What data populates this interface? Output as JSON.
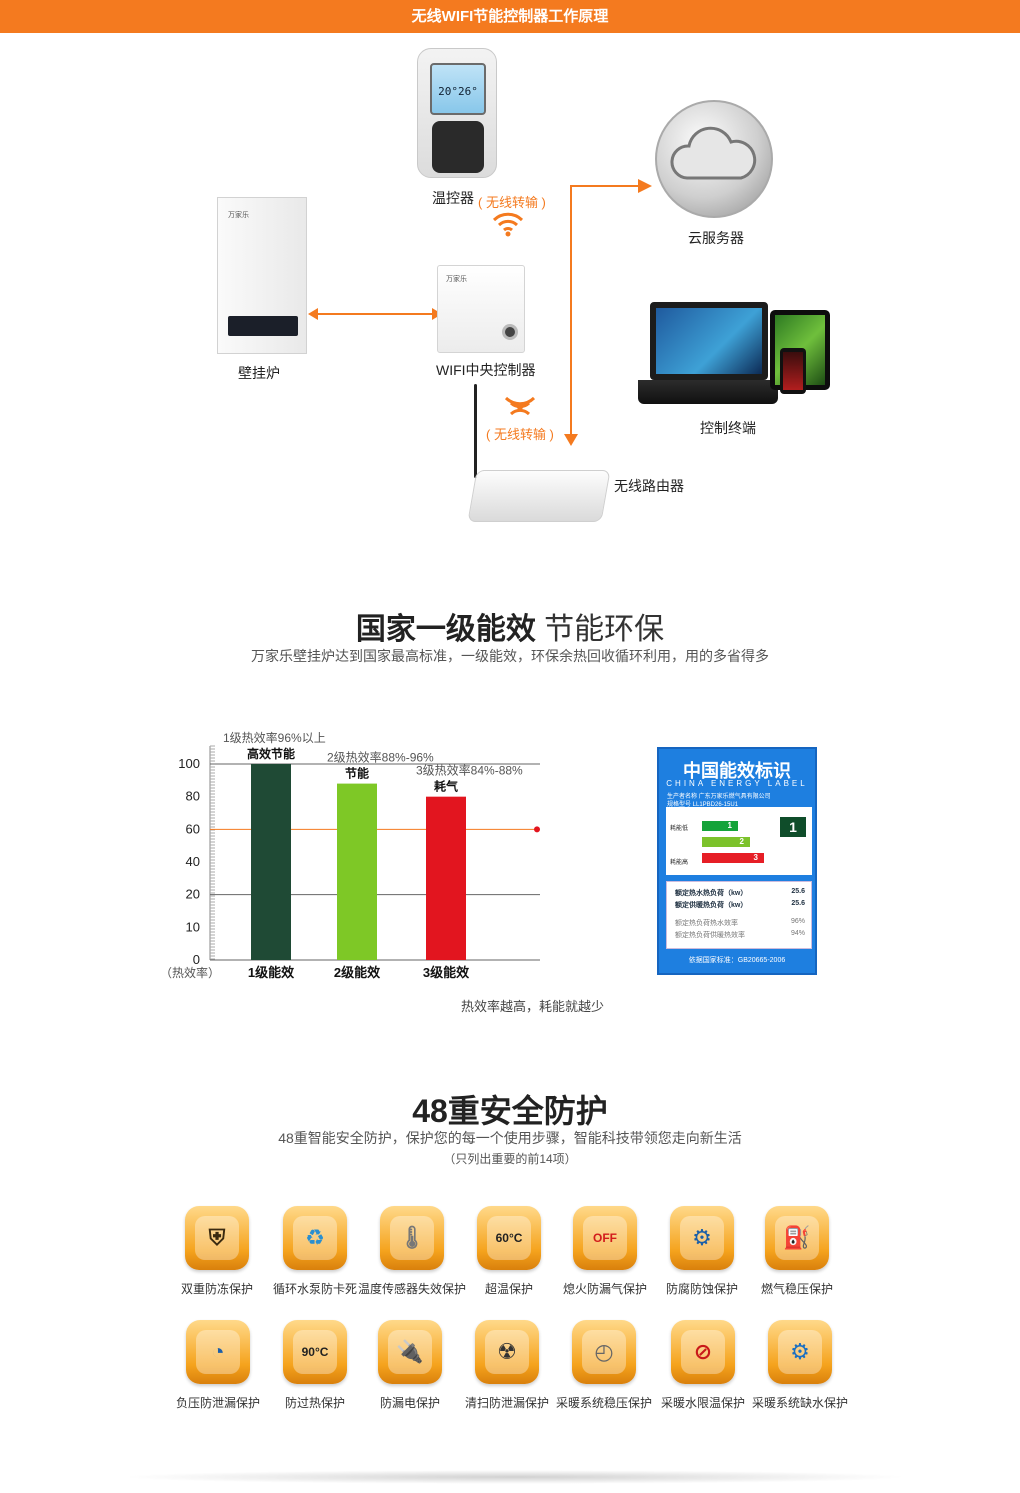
{
  "header": {
    "title": "无线WIFI节能控制器工作原理"
  },
  "diagram": {
    "thermostat_label": "温控器",
    "wireless_transfer_top": "( 无线转输 )",
    "thermostat_screen": "20°26°",
    "cloud_label": "云服务器",
    "boiler_label": "壁挂炉",
    "wifi_controller_label": "WIFI中央控制器",
    "terminal_label": "控制终端",
    "wireless_transfer_mid": "( 无线转输 )",
    "router_label": "无线路由器",
    "boiler_brand": "万家乐",
    "controller_brand": "万家乐"
  },
  "efficiency": {
    "title_bold": "国家一级能效",
    "title_light": "节能环保",
    "subtitle": "万家乐壁挂炉达到国家最高标准，一级能效，环保余热回收循环利用，用的多省得多",
    "caption": "热效率越高，耗能就越少"
  },
  "chart_data": {
    "type": "bar",
    "categories": [
      "1级能效",
      "2级能效",
      "3级能效"
    ],
    "values": [
      100,
      88,
      80
    ],
    "colors": [
      "#1f4a35",
      "#7ec826",
      "#e2151f"
    ],
    "bar_notes": [
      "1级热效率96%以上",
      "2级热效率88%-96%",
      "3级热效率84%-88%"
    ],
    "bar_titles": [
      "高效节能",
      "节能",
      "耗气"
    ],
    "ytick_labels": [
      "100",
      "80",
      "60",
      "40",
      "20",
      "10",
      "0"
    ],
    "ylabel": "（热效率）",
    "reference_line": 60,
    "reference_color": "#f47a1f"
  },
  "energy_label": {
    "title": "中国能效标识",
    "title_en": "CHINA ENERGY LABEL",
    "producer": "生产者名称  广东万家乐燃气具有限公司",
    "model": "规格型号  LL1PBD26-15U1",
    "low": "耗能低",
    "high": "耗能高",
    "grade_1": "1",
    "grade_2": "2",
    "grade_3": "3",
    "badge": "1",
    "row1_label": "额定热水热负荷（kw）",
    "row1_value": "25.6",
    "row2_label": "额定供暖热负荷（kw）",
    "row2_value": "25.6",
    "row3_label": "额定热负荷热水效率",
    "row3_value": "96%",
    "row4_label": "额定热负荷供暖热效率",
    "row4_value": "94%",
    "footer": "依据国家标准：GB20665-2006"
  },
  "safety": {
    "title": "48重安全防护",
    "subtitle": "48重智能安全防护，保护您的每一个使用步骤，智能科技带领您走向新生活",
    "note": "（只列出重要的前14项）",
    "row1": [
      {
        "label": "双重防冻保护",
        "icon": "shield-icon",
        "glyph": "⛨",
        "color": "#3a2a10"
      },
      {
        "label": "循环水泵防卡死",
        "icon": "recycle-icon",
        "glyph": "♻",
        "color": "#2a8fd0"
      },
      {
        "label": "温度传感器失效保护",
        "icon": "thermometer-icon",
        "glyph": "🌡",
        "color": "#777"
      },
      {
        "label": "超温保护",
        "icon": "temperature-shield-icon",
        "glyph": "60°C",
        "color": "#222"
      },
      {
        "label": "熄火防漏气保护",
        "icon": "off-valve-icon",
        "glyph": "OFF",
        "color": "#d21c1c"
      },
      {
        "label": "防腐防蚀保护",
        "icon": "anticorrosion-icon",
        "glyph": "⚙",
        "color": "#1b5fa8"
      },
      {
        "label": "燃气稳压保护",
        "icon": "gas-cylinder-icon",
        "glyph": "⛽",
        "color": "#c9171c"
      }
    ],
    "row2": [
      {
        "label": "负压防泄漏保护",
        "icon": "pressure-gauge-icon",
        "glyph": "◔",
        "color": "#1c5ea8"
      },
      {
        "label": "防过热保护",
        "icon": "overheat-shield-icon",
        "glyph": "90°C",
        "color": "#222"
      },
      {
        "label": "防漏电保护",
        "icon": "plug-icon",
        "glyph": "🔌",
        "color": "#2d9b3a"
      },
      {
        "label": "清扫防泄漏保护",
        "icon": "gas-mask-icon",
        "glyph": "☢",
        "color": "#333"
      },
      {
        "label": "采暖系统稳压保护",
        "icon": "gauge-shield-icon",
        "glyph": "◴",
        "color": "#666"
      },
      {
        "label": "采暖水限温保护",
        "icon": "no-fire-icon",
        "glyph": "⊘",
        "color": "#c91a1a"
      },
      {
        "label": "采暖系统缺水保护",
        "icon": "gear-water-icon",
        "glyph": "⚙",
        "color": "#1a6fc2"
      }
    ]
  }
}
